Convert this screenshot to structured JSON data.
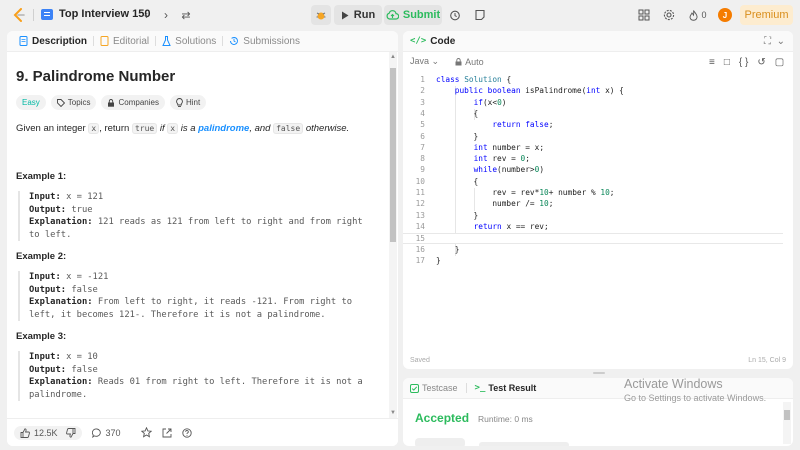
{
  "topbar": {
    "problem_list": "Top Interview 150",
    "run_label": "Run",
    "submit_label": "Submit",
    "streak_count": "0",
    "avatar_letter": "J",
    "premium_label": "Premium"
  },
  "left_tabs": [
    "Description",
    "Editorial",
    "Solutions",
    "Submissions"
  ],
  "problem": {
    "title": "9. Palindrome Number",
    "tags": [
      "Easy",
      "Topics",
      "Companies",
      "Hint"
    ],
    "statement": {
      "p1": "Given an integer ",
      "c1": "x",
      "p2": ", return ",
      "c2": "true",
      "p3": " if ",
      "c3": "x",
      "p4": " is a ",
      "link": "palindrome",
      "p5": ", and ",
      "c4": "false",
      "p6": " otherwise."
    },
    "examples": [
      {
        "title": "Example 1:",
        "input_label": "Input:",
        "input": "x = 121",
        "output_label": "Output:",
        "output": "true",
        "explanation_label": "Explanation:",
        "explanation": "121 reads as 121 from left to right and from right to left."
      },
      {
        "title": "Example 2:",
        "input_label": "Input:",
        "input": "x = -121",
        "output_label": "Output:",
        "output": "false",
        "explanation_label": "Explanation:",
        "explanation": "From left to right, it reads -121. From right to left, it becomes 121-. Therefore it is not a palindrome."
      },
      {
        "title": "Example 3:",
        "input_label": "Input:",
        "input": "x = 10",
        "output_label": "Output:",
        "output": "false",
        "explanation_label": "Explanation:",
        "explanation": "Reads 01 from right to left. Therefore it is not a palindrome."
      }
    ]
  },
  "left_footer": {
    "likes": "12.5K",
    "comments": "370"
  },
  "code": {
    "header": "Code",
    "language": "Java",
    "auto_label": "Auto",
    "lines": [
      "class Solution {",
      "    public boolean isPalindrome(int x) {",
      "        if(x<0)",
      "        {",
      "            return false;",
      "        }",
      "        int number = x;",
      "        int rev = 0;",
      "        while(number>0)",
      "        {",
      "            rev = rev*10+ number % 10;",
      "            number /= 10;",
      "        }",
      "        return x == rev;",
      "",
      "    }",
      "}"
    ],
    "saved_label": "Saved",
    "cursor_pos": "Ln 15, Col 9"
  },
  "result": {
    "tabs": [
      "Testcase",
      "Test Result"
    ],
    "status": "Accepted",
    "runtime": "Runtime: 0 ms"
  },
  "watermark": {
    "line1": "Activate Windows",
    "line2": "Go to Settings to activate Windows."
  },
  "colors": {
    "accepted": "#2cbb5d",
    "easy": "#00b8a3",
    "premium_text": "#d98e1c",
    "keyword": "#0000ff"
  }
}
